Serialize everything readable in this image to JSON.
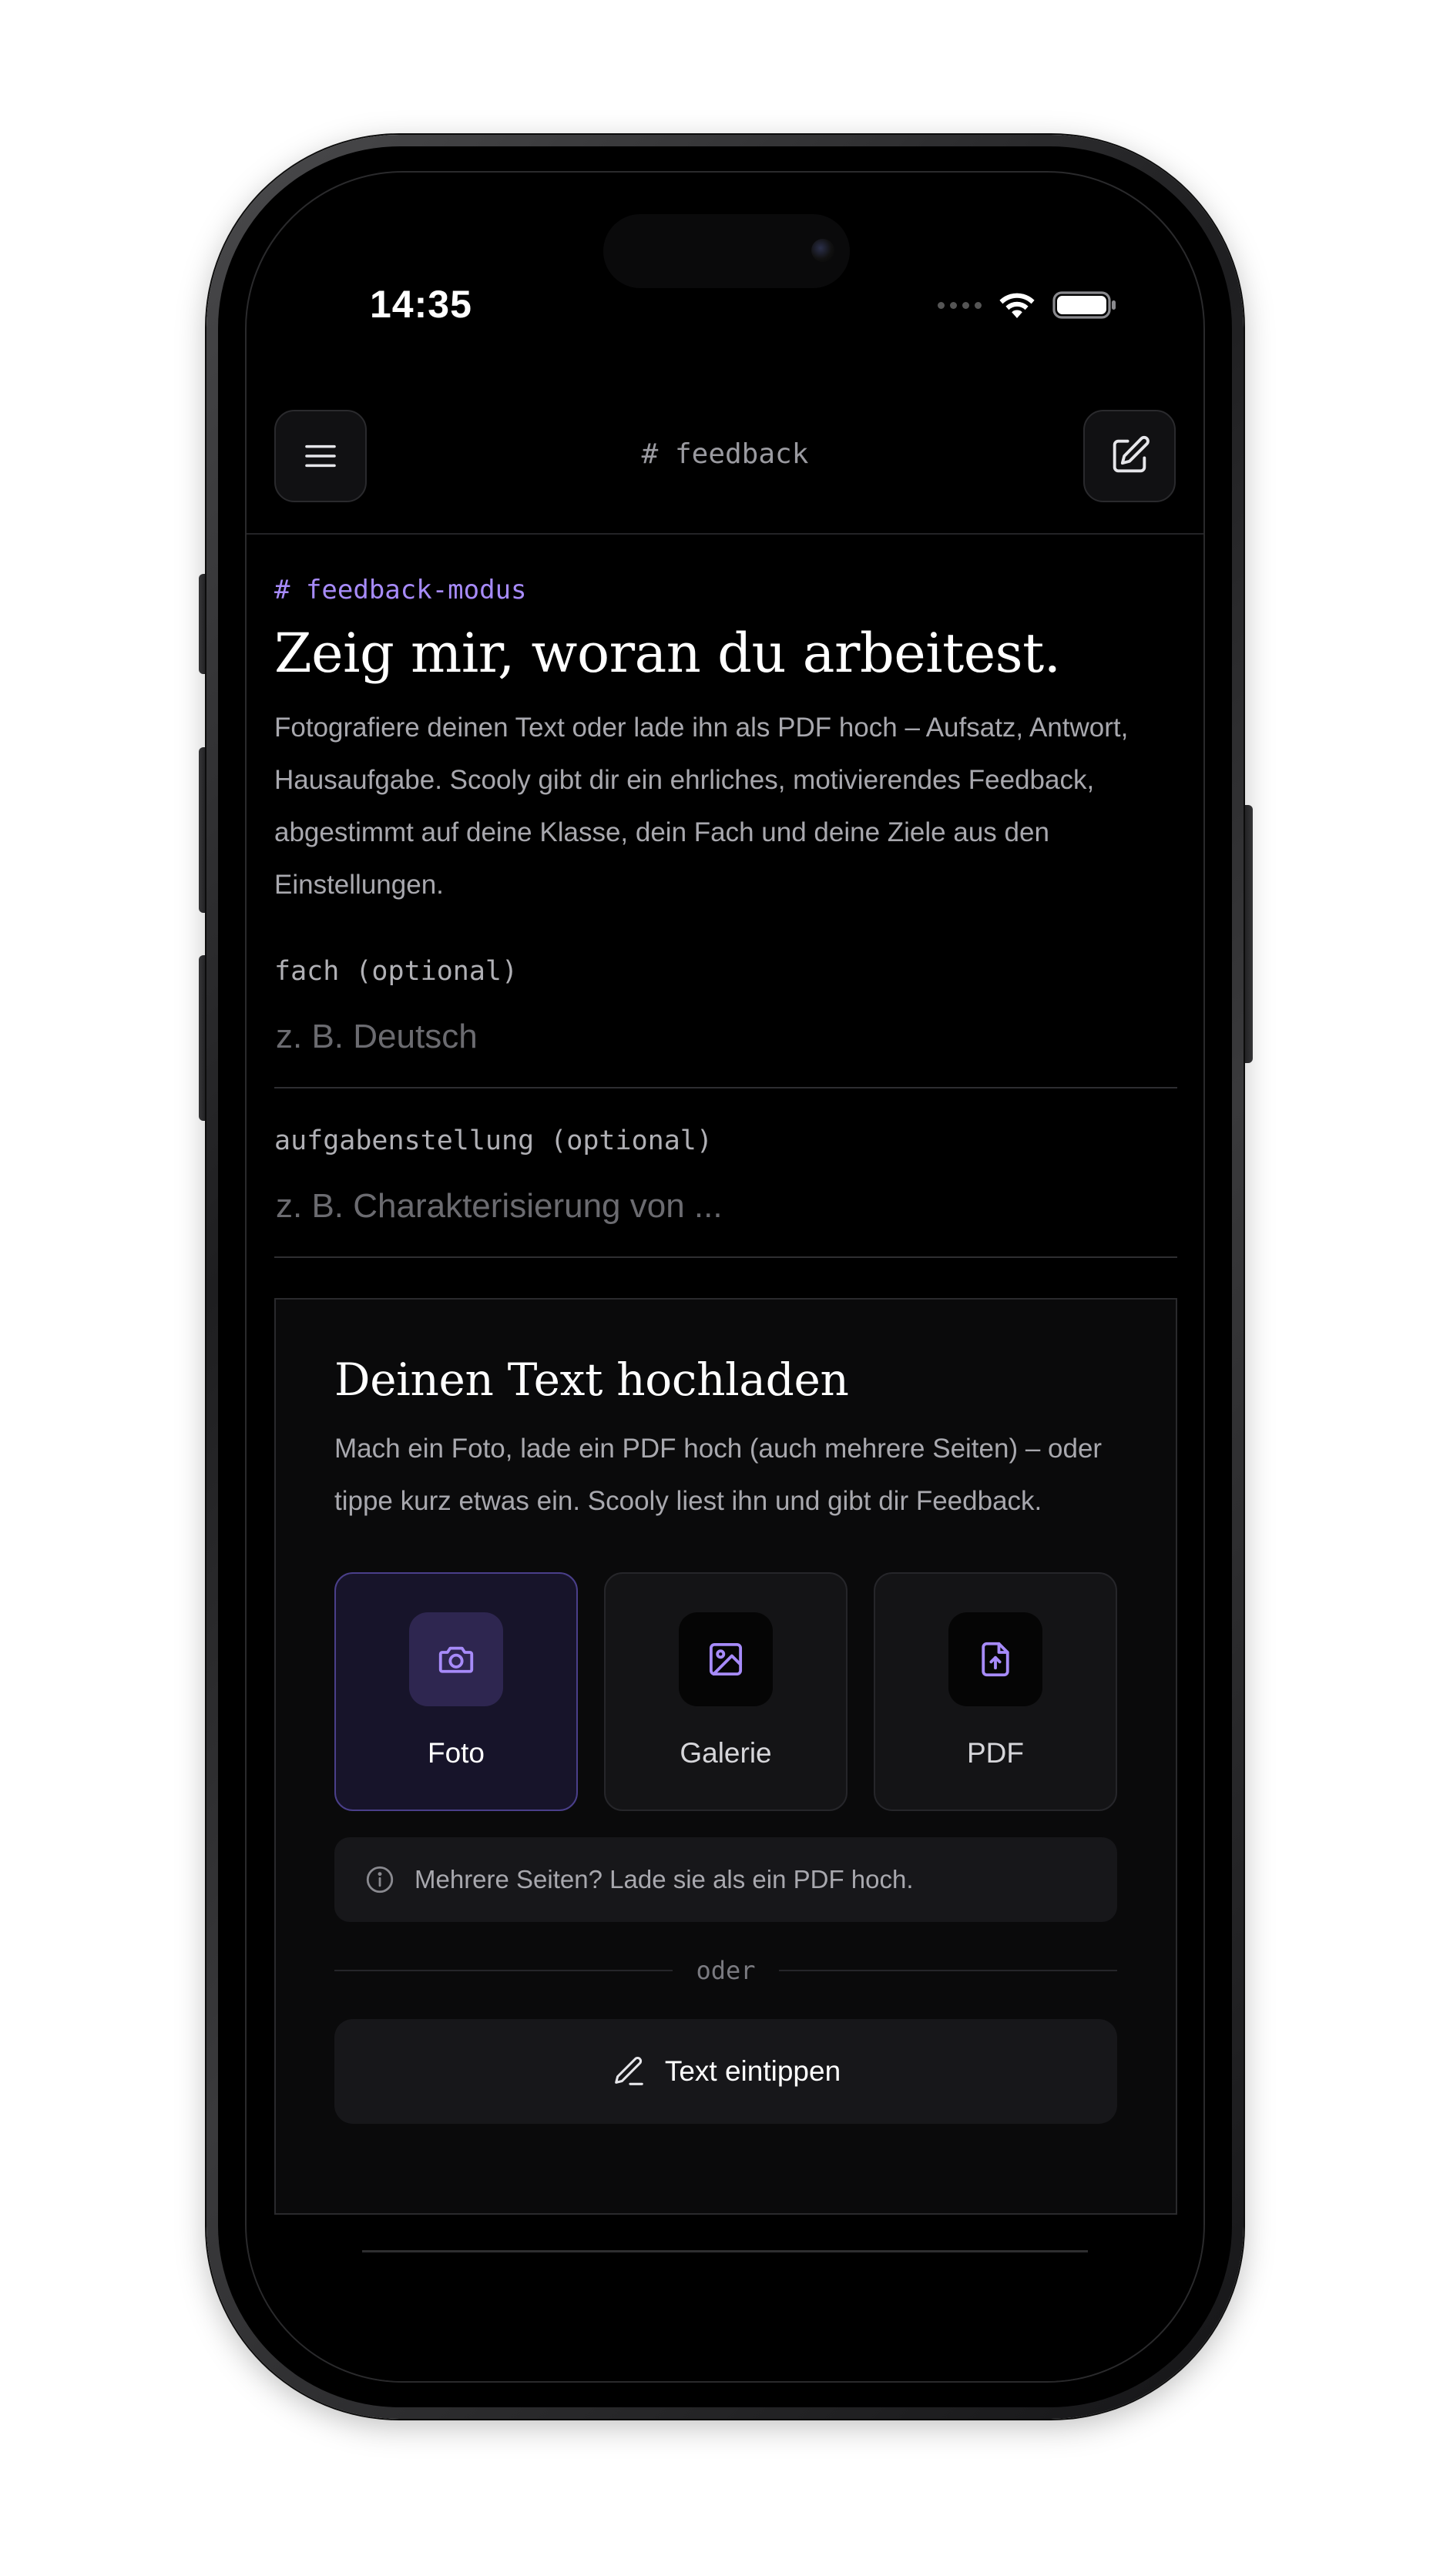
{
  "status_bar": {
    "time": "14:35"
  },
  "header": {
    "title": "# feedback"
  },
  "intro": {
    "tag": "# feedback-modus",
    "headline": "Zeig mir, woran du arbeitest.",
    "description": "Fotografiere deinen Text oder lade ihn als PDF hoch – Aufsatz, Antwort, Hausaufgabe. Scooly gibt dir ein ehrliches, motivierendes Feedback, abgestimmt auf deine Klasse, dein Fach und deine Ziele aus den Einstellungen."
  },
  "fields": {
    "subject": {
      "label": "fach (optional)",
      "placeholder": "z. B. Deutsch"
    },
    "task": {
      "label": "aufgabenstellung (optional)",
      "placeholder": "z. B. Charakterisierung von ..."
    }
  },
  "upload": {
    "title": "Deinen Text hochladen",
    "description": "Mach ein Foto, lade ein PDF hoch (auch mehrere Seiten) – oder tippe kurz etwas ein. Scooly liest ihn und gibt dir Feedback.",
    "options": [
      {
        "label": "Foto",
        "icon": "camera-icon",
        "selected": true
      },
      {
        "label": "Galerie",
        "icon": "image-icon",
        "selected": false
      },
      {
        "label": "PDF",
        "icon": "file-upload-icon",
        "selected": false
      }
    ],
    "hint": "Mehrere Seiten? Lade sie als ein PDF hoch.",
    "divider": "oder",
    "type_button": "Text eintippen"
  },
  "colors": {
    "accent": "#a78bfa",
    "background": "#000000"
  }
}
